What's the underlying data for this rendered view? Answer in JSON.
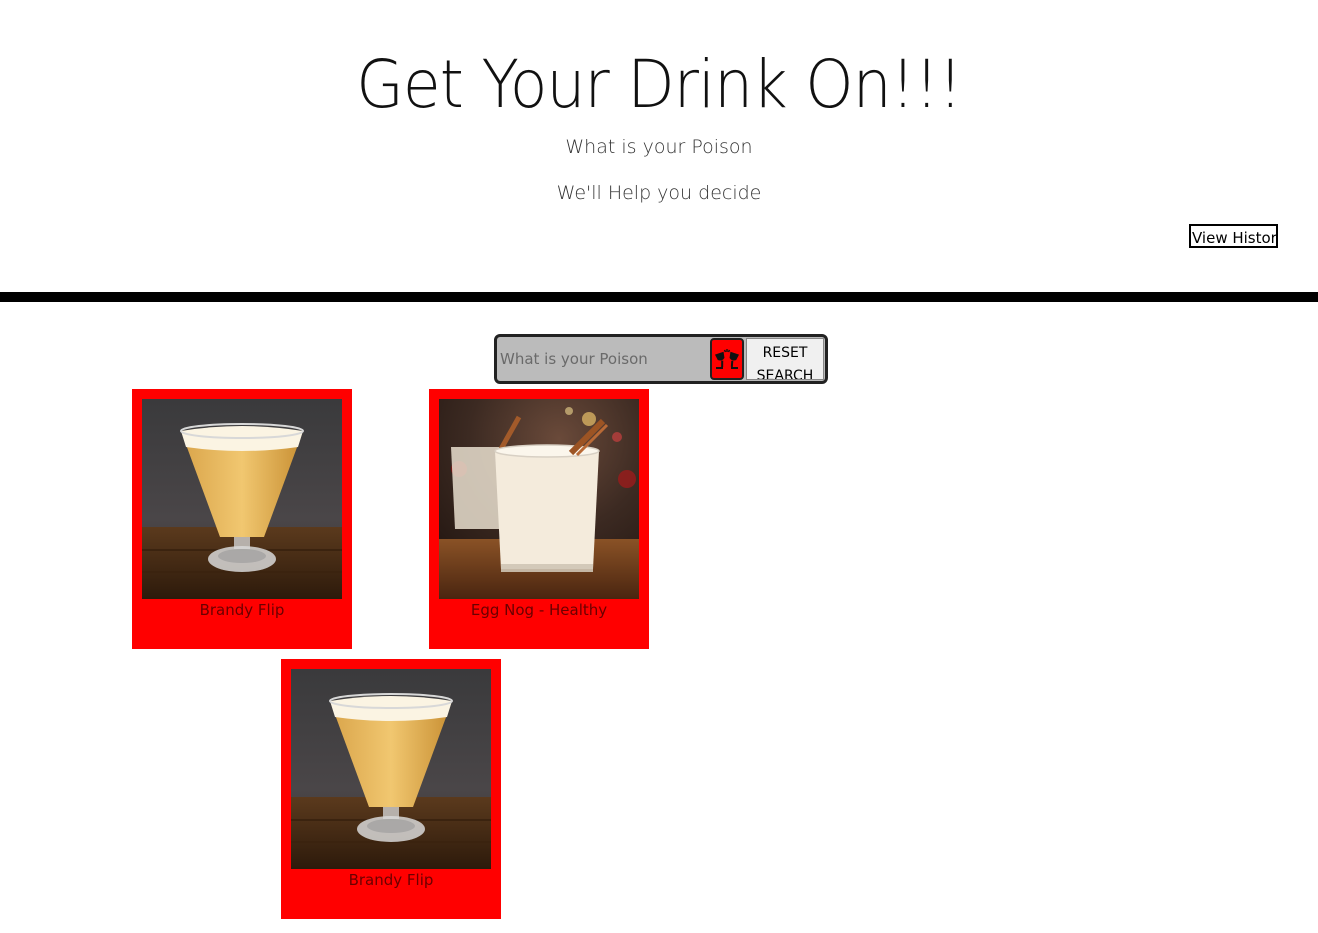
{
  "header": {
    "title": "Get Your Drink On!!!",
    "subtitle_1": "What is your Poison",
    "subtitle_2": "We'll Help you decide",
    "history_button": "View History"
  },
  "search": {
    "placeholder": "What is your Poison",
    "value": "",
    "search_icon": "cocktail-glasses-icon",
    "reset_label": "RESET SEARCH"
  },
  "colors": {
    "card_background": "#ff0000",
    "divider": "#000000",
    "search_field": "#bbbbbb"
  },
  "results": [
    {
      "name": "Brandy Flip",
      "image": "brandy-flip-photo"
    },
    {
      "name": "Egg Nog - Healthy",
      "image": "egg-nog-photo"
    },
    {
      "name": "Brandy Flip",
      "image": "brandy-flip-photo"
    }
  ]
}
